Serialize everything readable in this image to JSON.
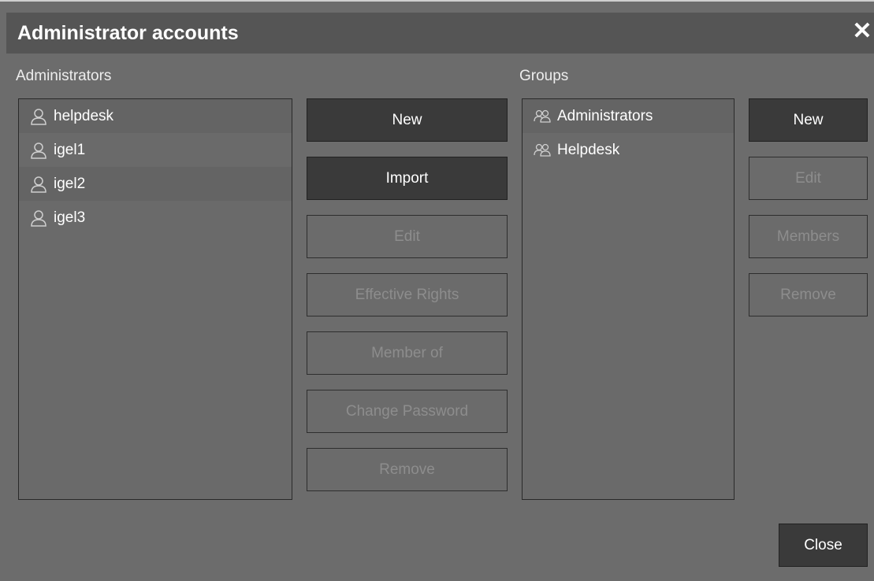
{
  "window": {
    "title": "Administrator accounts",
    "close_glyph": "✕"
  },
  "administrators": {
    "label": "Administrators",
    "items": [
      {
        "name": "helpdesk",
        "icon": "user-icon"
      },
      {
        "name": "igel1",
        "icon": "user-icon"
      },
      {
        "name": "igel2",
        "icon": "user-icon"
      },
      {
        "name": "igel3",
        "icon": "user-icon"
      }
    ],
    "buttons": {
      "new": "New",
      "import": "Import",
      "edit": "Edit",
      "effective_rights": "Effective Rights",
      "member_of": "Member of",
      "change_password": "Change Password",
      "remove": "Remove"
    }
  },
  "groups": {
    "label": "Groups",
    "items": [
      {
        "name": "Administrators",
        "icon": "group-icon"
      },
      {
        "name": "Helpdesk",
        "icon": "group-icon"
      }
    ],
    "buttons": {
      "new": "New",
      "edit": "Edit",
      "members": "Members",
      "remove": "Remove"
    }
  },
  "footer": {
    "close": "Close"
  },
  "colors": {
    "background": "#6c6c6c",
    "titlebar": "#555555",
    "active_button": "#3a3a3a"
  }
}
